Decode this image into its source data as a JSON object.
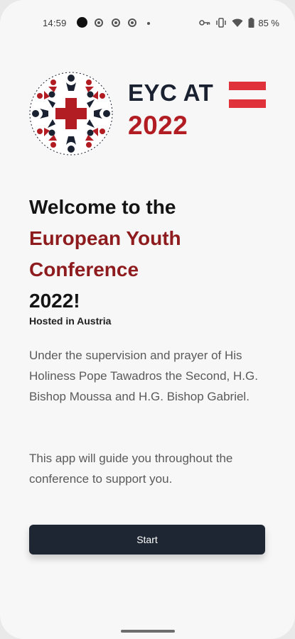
{
  "status_bar": {
    "time": "14:59",
    "battery": "85 %",
    "icons": [
      "camera-icon",
      "chrome-icon",
      "chrome-icon",
      "chrome-icon",
      "dot-icon",
      "key-icon",
      "vibrate-icon",
      "wifi-icon",
      "battery-icon"
    ]
  },
  "header": {
    "title": "EYC AT",
    "year": "2022",
    "flag_colors": [
      "#e0323a",
      "#f7f7f7",
      "#e0323a"
    ],
    "brand_dark": "#1a2130",
    "brand_red": "#b11d22"
  },
  "welcome": {
    "line1": "Welcome to the",
    "highlight1": "European Youth",
    "highlight2": "Conference",
    "line3": "2022!",
    "hosted": "Hosted in Austria"
  },
  "body": {
    "paragraph1": "Under the supervision and prayer of His Holiness Pope Tawadros the Second, H.G. Bishop Moussa and H.G. Bishop Gabriel.",
    "paragraph2": "This app will guide you throughout the conference to support you."
  },
  "actions": {
    "start_label": "Start",
    "accent": "#1e2633"
  }
}
